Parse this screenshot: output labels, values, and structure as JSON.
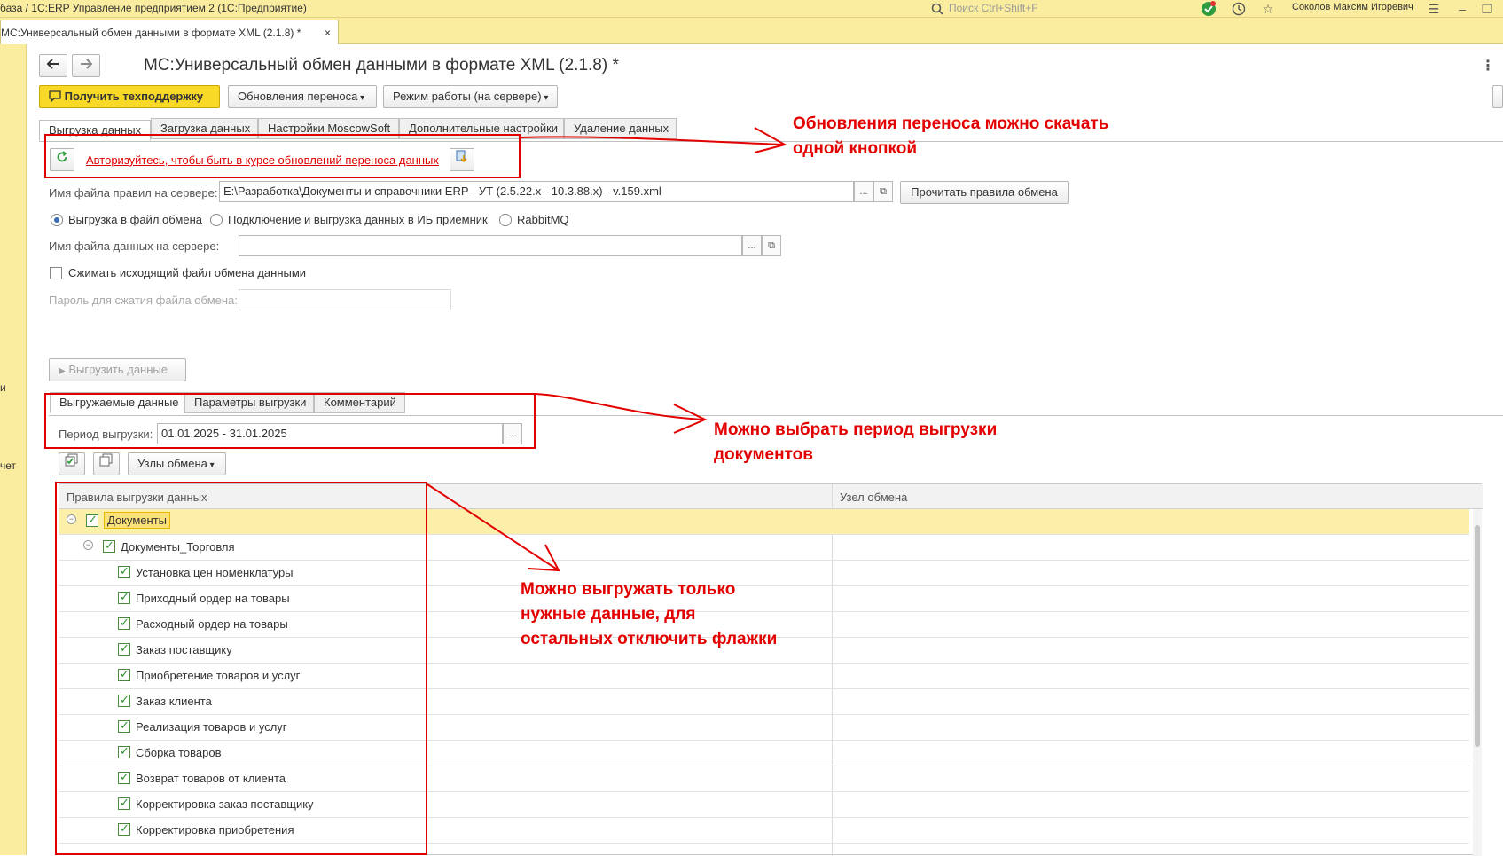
{
  "titlebar": {
    "title": "база / 1С:ERP Управление предприятием 2  (1С:Предприятие)",
    "search_placeholder": "Поиск Ctrl+Shift+F",
    "user": "Соколов Максим Игоревич"
  },
  "window_tab": {
    "label": "MC:Универсальный обмен данными в формате XML (2.1.8) *",
    "close": "×"
  },
  "left_panel": {
    "frag1": "и",
    "frag2": "чет"
  },
  "form": {
    "title": "MC:Универсальный обмен данными в формате XML (2.1.8) *",
    "support_button": "Получить техподдержку",
    "updates_button": "Обновления переноса",
    "mode_button": "Режим работы (на сервере)",
    "tabs": [
      {
        "label": "Выгрузка данных"
      },
      {
        "label": "Загрузка данных"
      },
      {
        "label": "Настройки MoscowSoft"
      },
      {
        "label": "Дополнительные настройки"
      },
      {
        "label": "Удаление данных"
      }
    ],
    "auth_link": "Авторизуйтесь, чтобы быть в курсе обновлений переноса данных",
    "rules_label": "Имя файла правил на сервере:",
    "rules_value": "E:\\Разработка\\Документы и справочники ERP - УТ (2.5.22.x - 10.3.88.x) - v.159.xml",
    "read_rules_button": "Прочитать правила обмена",
    "radio_file": "Выгрузка в файл обмена",
    "radio_ib": "Подключение и выгрузка данных в ИБ приемник",
    "radio_mq": "RabbitMQ",
    "data_file_label": "Имя файла данных на сервере:",
    "data_file_value": "",
    "compress_label": "Сжимать исходящий файл обмена данными",
    "password_label": "Пароль для сжатия файла обмена:",
    "export_button": "Выгрузить данные",
    "subtabs": [
      {
        "label": "Выгружаемые данные"
      },
      {
        "label": "Параметры выгрузки"
      },
      {
        "label": "Комментарий"
      }
    ],
    "period_label": "Период выгрузки:",
    "period_value": "01.01.2025 - 31.01.2025",
    "nodes_button": "Узлы обмена",
    "ellipsis": "..."
  },
  "grid": {
    "col1": "Правила выгрузки данных",
    "col2": "Узел обмена",
    "rows": [
      {
        "label": "Документы",
        "level": 0,
        "checked": true,
        "toggle": "−"
      },
      {
        "label": "Документы_Торговля",
        "level": 1,
        "checked": true,
        "toggle": "−"
      },
      {
        "label": "Установка цен номенклатуры",
        "level": 2,
        "checked": true
      },
      {
        "label": "Приходный ордер на товары",
        "level": 2,
        "checked": true
      },
      {
        "label": "Расходный ордер на товары",
        "level": 2,
        "checked": true
      },
      {
        "label": "Заказ поставщику",
        "level": 2,
        "checked": true
      },
      {
        "label": "Приобретение товаров и услуг",
        "level": 2,
        "checked": true
      },
      {
        "label": "Заказ клиента",
        "level": 2,
        "checked": true
      },
      {
        "label": "Реализация товаров и услуг",
        "level": 2,
        "checked": true
      },
      {
        "label": "Сборка товаров",
        "level": 2,
        "checked": true
      },
      {
        "label": "Возврат товаров от клиента",
        "level": 2,
        "checked": true
      },
      {
        "label": "Корректировка заказ поставщику",
        "level": 2,
        "checked": true
      },
      {
        "label": "Корректировка приобретения",
        "level": 2,
        "checked": true
      }
    ]
  },
  "annotations": {
    "a1": "Обновления переноса можно скачать\nодной кнопкой",
    "a2": "Можно выбрать период выгрузки\nдокументов",
    "a3": "Можно выгружать только\nнужные данные, для\nостальных отключить флажки"
  },
  "colors": {
    "accent_yellow": "#f8d928",
    "annotation_red": "#e30000",
    "panel_yellow": "#fbeda0"
  }
}
